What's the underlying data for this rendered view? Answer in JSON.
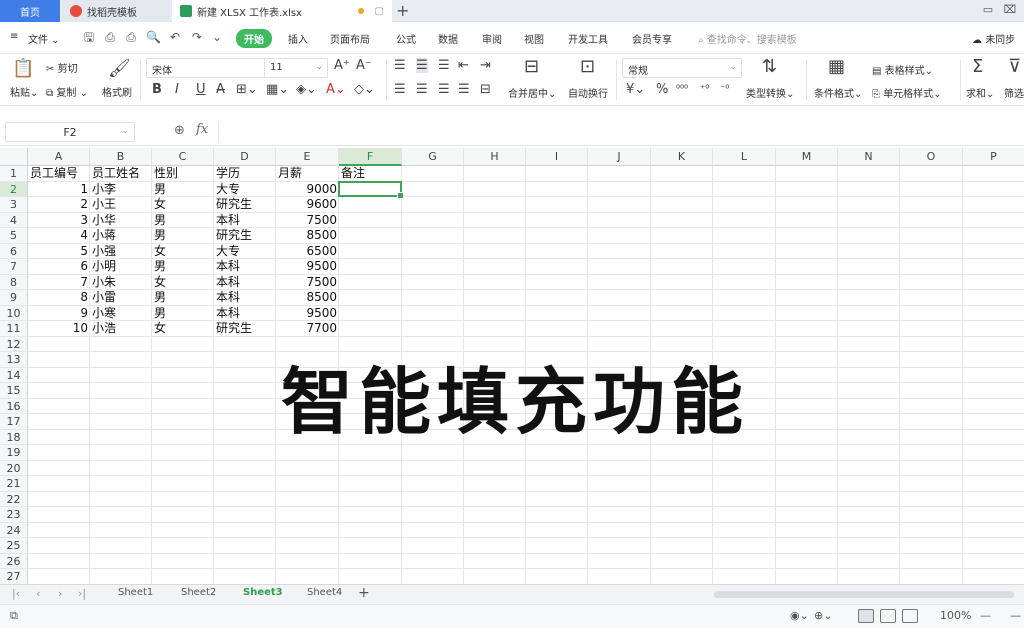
{
  "tabs": [
    {
      "label": "首页"
    },
    {
      "label": "找稻壳模板"
    },
    {
      "label": "新建 XLSX 工作表.xlsx"
    }
  ],
  "menu": {
    "file": "文件",
    "items": [
      "开始",
      "插入",
      "页面布局",
      "公式",
      "数据",
      "审阅",
      "视图",
      "开发工具",
      "会员专享"
    ],
    "search_placeholder": "查找命令、搜索模板",
    "sync": "未同步"
  },
  "ribbon": {
    "paste": "粘贴",
    "cut": "剪切",
    "copy": "复制",
    "format_painter": "格式刷",
    "font_name": "宋体",
    "font_size": "11",
    "merge": "合并居中",
    "wrap": "自动换行",
    "number_format": "常规",
    "type_convert": "类型转换",
    "cond_format": "条件格式",
    "table_style": "表格样式",
    "cell_style": "单元格样式",
    "sum": "求和",
    "filter": "筛选"
  },
  "formula_bar": {
    "name_box": "F2",
    "fx": "fx",
    "value": ""
  },
  "sheet": {
    "columns": [
      "A",
      "B",
      "C",
      "D",
      "E",
      "F",
      "G",
      "H",
      "I",
      "J",
      "K",
      "L",
      "M",
      "N",
      "O",
      "P"
    ],
    "selected_column": "F",
    "selected_row": 2,
    "row_count": 27,
    "header": [
      "员工编号",
      "员工姓名",
      "性别",
      "学历",
      "月薪",
      "备注"
    ],
    "rows": [
      [
        1,
        "小李",
        "男",
        "大专",
        9000
      ],
      [
        2,
        "小王",
        "女",
        "研究生",
        9600
      ],
      [
        3,
        "小华",
        "男",
        "本科",
        7500
      ],
      [
        4,
        "小蒋",
        "男",
        "研究生",
        8500
      ],
      [
        5,
        "小强",
        "女",
        "大专",
        6500
      ],
      [
        6,
        "小明",
        "男",
        "本科",
        9500
      ],
      [
        7,
        "小朱",
        "女",
        "本科",
        7500
      ],
      [
        8,
        "小雷",
        "男",
        "本科",
        8500
      ],
      [
        9,
        "小寒",
        "男",
        "本科",
        9500
      ],
      [
        10,
        "小浩",
        "女",
        "研究生",
        7700
      ]
    ]
  },
  "overlay_caption": "智能填充功能",
  "sheet_tabs": [
    "Sheet1",
    "Sheet2",
    "Sheet3",
    "Sheet4"
  ],
  "active_sheet": "Sheet3",
  "status": {
    "zoom": "100%"
  },
  "colors": {
    "accent": "#3ba55c",
    "home_tab": "#3f7ee8"
  }
}
